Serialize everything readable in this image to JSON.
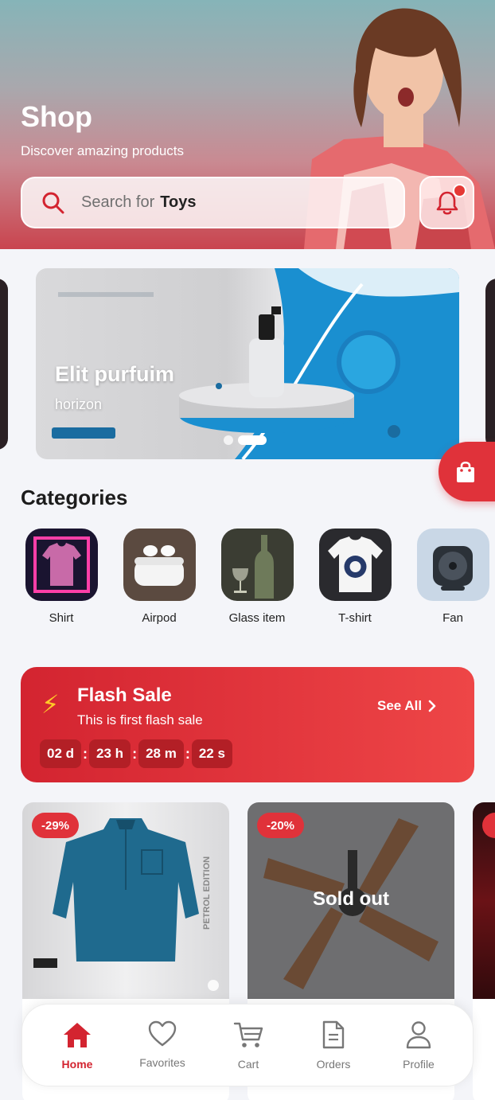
{
  "header": {
    "title": "Shop",
    "subtitle": "Discover amazing products",
    "search": {
      "placeholder": "Search for",
      "keyword": "Toys"
    }
  },
  "banner": {
    "title": "Elit purfuim",
    "subtitle": "horizon",
    "slide_count": 2,
    "active_slide": 2
  },
  "categories": {
    "heading": "Categories",
    "items": [
      {
        "label": "Shirt"
      },
      {
        "label": "Airpod"
      },
      {
        "label": "Glass item"
      },
      {
        "label": "T-shirt"
      },
      {
        "label": "Fan"
      }
    ]
  },
  "flash_sale": {
    "title": "Flash Sale",
    "subtitle": "This is first flash sale",
    "see_all": "See All",
    "timer": {
      "days": "02 d",
      "hours": "23 h",
      "minutes": "28 m",
      "seconds": "22 s"
    }
  },
  "products": [
    {
      "discount": "-29%",
      "sold_out": false
    },
    {
      "discount": "-20%",
      "sold_out": true,
      "status": "Sold out"
    }
  ],
  "nav": {
    "items": [
      {
        "label": "Home",
        "icon": "home-icon",
        "active": true
      },
      {
        "label": "Favorites",
        "icon": "heart-icon",
        "active": false
      },
      {
        "label": "Cart",
        "icon": "cart-icon",
        "active": false
      },
      {
        "label": "Orders",
        "icon": "document-icon",
        "active": false
      },
      {
        "label": "Profile",
        "icon": "person-icon",
        "active": false
      }
    ]
  },
  "colors": {
    "accent": "#e0323a",
    "accent_dark": "#b31f26",
    "bolt": "#ffc928",
    "background": "#f4f5f9"
  }
}
